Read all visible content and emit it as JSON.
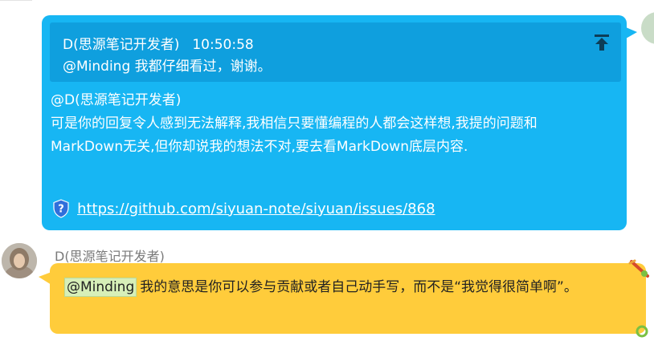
{
  "outgoing": {
    "quote": {
      "sender": "D(思源笔记开发者)",
      "time": "10:50:58",
      "text": "@Minding 我都仔细看过，谢谢。"
    },
    "lines": [
      "@D(思源笔记开发者)",
      "可是你的回复令人感到无法解释,我相信只要懂编程的人都会这样想,我提的问题和",
      "MarkDown无关,但你却说我的想法不对,要去看MarkDown底层内容."
    ],
    "link": "https://github.com/siyuan-note/siyuan/issues/868"
  },
  "incoming": {
    "sender": "D(思源笔记开发者)",
    "mention": "@Minding",
    "text": "我的意思是你可以参与贡献或者自己动手写，而不是“我觉得很简单啊”。"
  },
  "colors": {
    "outgoing_bubble": "#17b6f3",
    "quote_background": "#0f9fde",
    "incoming_bubble": "#ffcc3b",
    "mention_highlight": "#d7efb8"
  },
  "icons": {
    "pin": "pin-top-icon",
    "link": "shield-question-icon"
  }
}
